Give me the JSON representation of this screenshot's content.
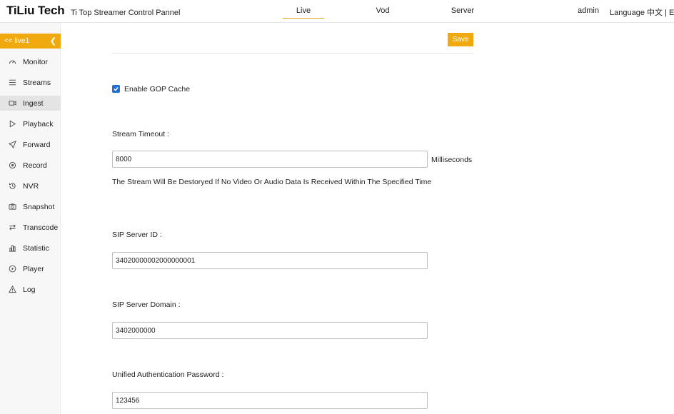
{
  "header": {
    "brand": "TiLiu Tech",
    "subtitle": "Ti Top Streamer Control Pannel",
    "tabs": [
      {
        "label": "Live",
        "active": true
      },
      {
        "label": "Vod",
        "active": false
      },
      {
        "label": "Server",
        "active": false
      }
    ],
    "user": "admin",
    "language": "Language 中文 | EN"
  },
  "sidebar": {
    "head_label": "<< live1",
    "collapse_icon": "chevron-left-icon",
    "items": [
      {
        "label": "Monitor",
        "icon": "gauge-icon"
      },
      {
        "label": "Streams",
        "icon": "list-icon"
      },
      {
        "label": "Ingest",
        "icon": "video-camera-icon",
        "active": true
      },
      {
        "label": "Playback",
        "icon": "play-icon"
      },
      {
        "label": "Forward",
        "icon": "send-icon"
      },
      {
        "label": "Record",
        "icon": "record-icon"
      },
      {
        "label": "NVR",
        "icon": "history-icon"
      },
      {
        "label": "Snapshot",
        "icon": "camera-icon"
      },
      {
        "label": "Transcode",
        "icon": "swap-icon"
      },
      {
        "label": "Statistic",
        "icon": "bar-chart-icon"
      },
      {
        "label": "Player",
        "icon": "play-circle-icon"
      },
      {
        "label": "Log",
        "icon": "warning-icon"
      }
    ]
  },
  "main": {
    "save_label": "Save",
    "gop_cache": {
      "label": "Enable GOP Cache",
      "checked": true
    },
    "stream_timeout": {
      "label": "Stream Timeout :",
      "value": "8000",
      "unit": "Milliseconds",
      "hint": "The Stream Will Be Destoryed If No Video Or Audio Data Is Received Within The Specified Time"
    },
    "sip_server_id": {
      "label": "SIP Server ID :",
      "value": "34020000002000000001"
    },
    "sip_server_domain": {
      "label": "SIP Server Domain :",
      "value": "3402000000"
    },
    "auth_password": {
      "label": "Unified Authentication Password :",
      "value": "123456"
    }
  },
  "colors": {
    "accent": "#f0a90f",
    "checkbox": "#1f6fd6"
  }
}
